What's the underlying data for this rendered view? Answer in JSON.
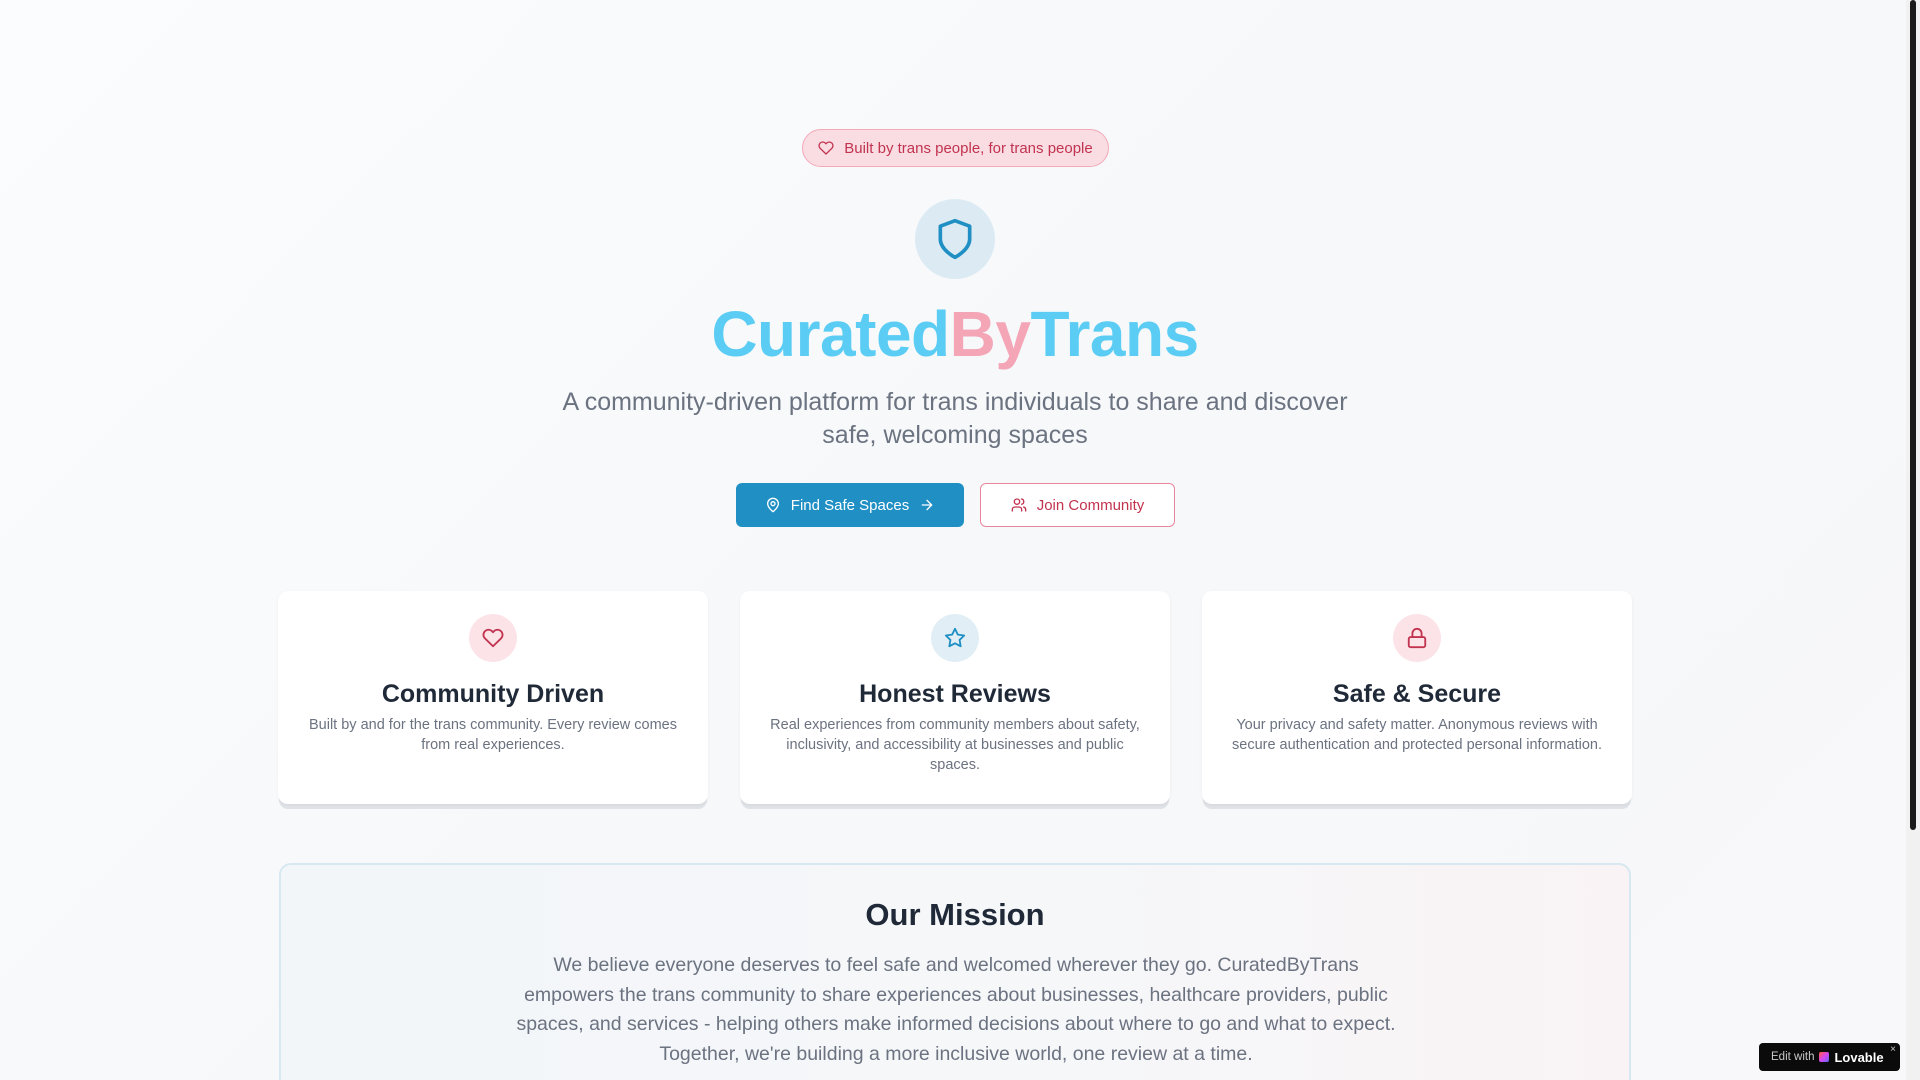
{
  "hero": {
    "badge_label": "Built by trans people, for trans people",
    "title_part1": "Curated",
    "title_part2": "By",
    "title_part3": "Trans",
    "subtitle": "A community-driven platform for trans individuals to share and discover safe, welcoming spaces",
    "primary_button_label": "Find Safe Spaces",
    "secondary_button_label": "Join Community"
  },
  "features": [
    {
      "icon": "heart-icon",
      "title": "Community Driven",
      "description": "Built by and for the trans community. Every review comes from real experiences."
    },
    {
      "icon": "star-icon",
      "title": "Honest Reviews",
      "description": "Real experiences from community members about safety, inclusivity, and accessibility at businesses and public spaces."
    },
    {
      "icon": "lock-icon",
      "title": "Safe & Secure",
      "description": "Your privacy and safety matter. Anonymous reviews with secure authentication and protected personal information."
    }
  ],
  "mission": {
    "title": "Our Mission",
    "text": "We believe everyone deserves to feel safe and welcomed wherever they go. CuratedByTrans empowers the trans community to share experiences about businesses, healthcare providers, public spaces, and services - helping others make informed decisions about where to go and what to expect. Together, we're building a more inclusive world, one review at a time."
  },
  "lovable_badge": {
    "edit_label": "Edit with",
    "brand_label": "Lovable",
    "close_label": "×"
  },
  "colors": {
    "primary_blue": "#1f8fc4",
    "title_blue": "#5bcdf4",
    "title_pink": "#f4a6b7",
    "accent_pink": "#c2334f"
  }
}
